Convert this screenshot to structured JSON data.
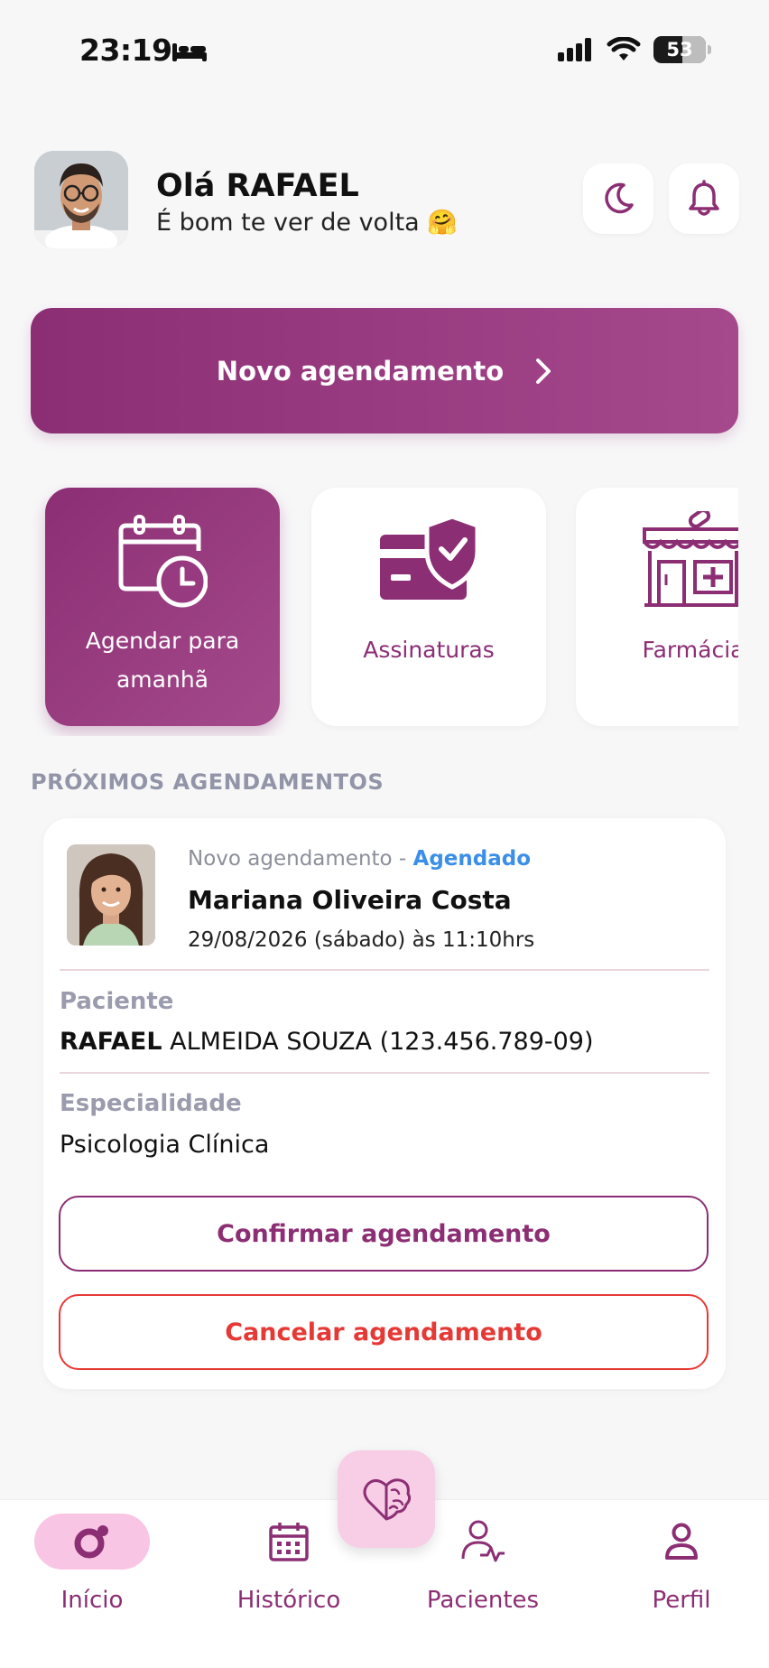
{
  "status_bar": {
    "time": "23:19",
    "battery": "53",
    "icons": [
      "bed-icon",
      "signal-icon",
      "wifi-icon",
      "battery-icon"
    ]
  },
  "header": {
    "greeting": "Olá RAFAEL",
    "subtitle": "É bom te ver de volta 🤗",
    "icons": [
      "moon-icon",
      "bell-icon"
    ]
  },
  "primary_action": {
    "label": "Novo agendamento",
    "icon": "chevron-right-icon"
  },
  "shortcuts": [
    {
      "line1": "Agendar para",
      "line2": "amanhã",
      "icon": "calendar-clock-icon",
      "active": true
    },
    {
      "label": "Assinaturas",
      "icon": "card-shield-icon"
    },
    {
      "label": "Farmácia",
      "icon": "pharmacy-store-icon"
    }
  ],
  "section_title": "PRÓXIMOS AGENDAMENTOS",
  "appointment": {
    "type": "Novo agendamento",
    "separator": " - ",
    "status": "Agendado",
    "professional": "Mariana Oliveira Costa",
    "datetime": "29/08/2026 (sábado) às 11:10hrs",
    "patient_label": "Paciente",
    "patient_first": "RAFAEL",
    "patient_rest": " ALMEIDA SOUZA (123.456.789-09)",
    "specialty_label": "Especialidade",
    "specialty": "Psicologia Clínica",
    "confirm_label": "Confirmar agendamento",
    "cancel_label": "Cancelar agendamento"
  },
  "bottom_nav": {
    "items": [
      {
        "label": "Início",
        "icon": "home-brand-icon",
        "active": true
      },
      {
        "label": "Histórico",
        "icon": "calendar-icon"
      },
      {
        "label": "Pacientes",
        "icon": "patient-health-icon"
      },
      {
        "label": "Perfil",
        "icon": "user-icon"
      }
    ],
    "fab_icon": "heart-brain-icon"
  },
  "colors": {
    "brand": "#8c2e74",
    "brand_light": "#f8c6e4",
    "status_blue": "#3b8fe8",
    "danger": "#e53935",
    "muted": "#9295a8"
  }
}
